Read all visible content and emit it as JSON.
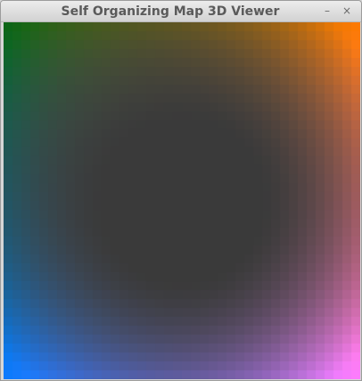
{
  "window": {
    "title": "Self Organizing Map 3D Viewer",
    "minimize_glyph": "–",
    "close_glyph": "×"
  },
  "som_grid": {
    "columns": 40,
    "rows": 40,
    "center_color": "#3a3a3a",
    "corner_colors": {
      "top_left": "#0a6414",
      "top_right": "#ff7a00",
      "bottom_left": "#0a7aff",
      "bottom_right": "#ff7cff"
    }
  }
}
